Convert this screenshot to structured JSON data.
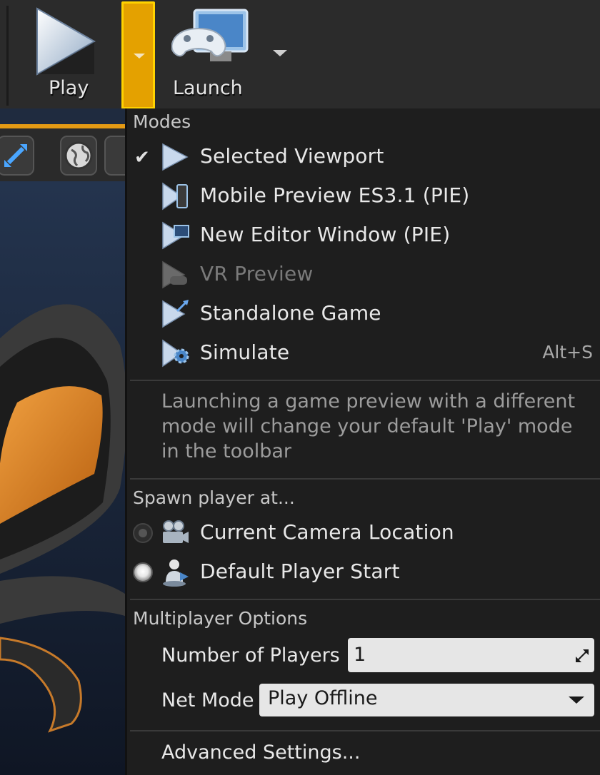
{
  "toolbar": {
    "play_label": "Play",
    "launch_label": "Launch"
  },
  "menu": {
    "modes_title": "Modes",
    "modes": [
      {
        "label": "Selected Viewport",
        "checked": true,
        "icon": "play-icon"
      },
      {
        "label": "Mobile Preview ES3.1 (PIE)",
        "icon": "mobile-preview-icon"
      },
      {
        "label": "New Editor Window (PIE)",
        "icon": "editor-window-icon"
      },
      {
        "label": "VR Preview",
        "disabled": true,
        "icon": "vr-preview-icon"
      },
      {
        "label": "Standalone Game",
        "icon": "standalone-game-icon"
      },
      {
        "label": "Simulate",
        "shortcut": "Alt+S",
        "icon": "simulate-icon"
      }
    ],
    "hint": "Launching a game preview with a different mode will change your default 'Play' mode in the toolbar",
    "spawn_title": "Spawn player at...",
    "spawn": [
      {
        "label": "Current Camera Location",
        "selected": false,
        "icon": "camera-icon"
      },
      {
        "label": "Default Player Start",
        "selected": true,
        "icon": "player-start-icon"
      }
    ],
    "multiplayer_title": "Multiplayer Options",
    "num_players_label": "Number of Players",
    "num_players_value": "1",
    "net_mode_label": "Net Mode",
    "net_mode_value": "Play Offline",
    "advanced_label": "Advanced Settings..."
  },
  "colors": {
    "accent": "#e4a100",
    "accent_border": "#ffd200",
    "menu_bg": "#1e1e1e"
  }
}
